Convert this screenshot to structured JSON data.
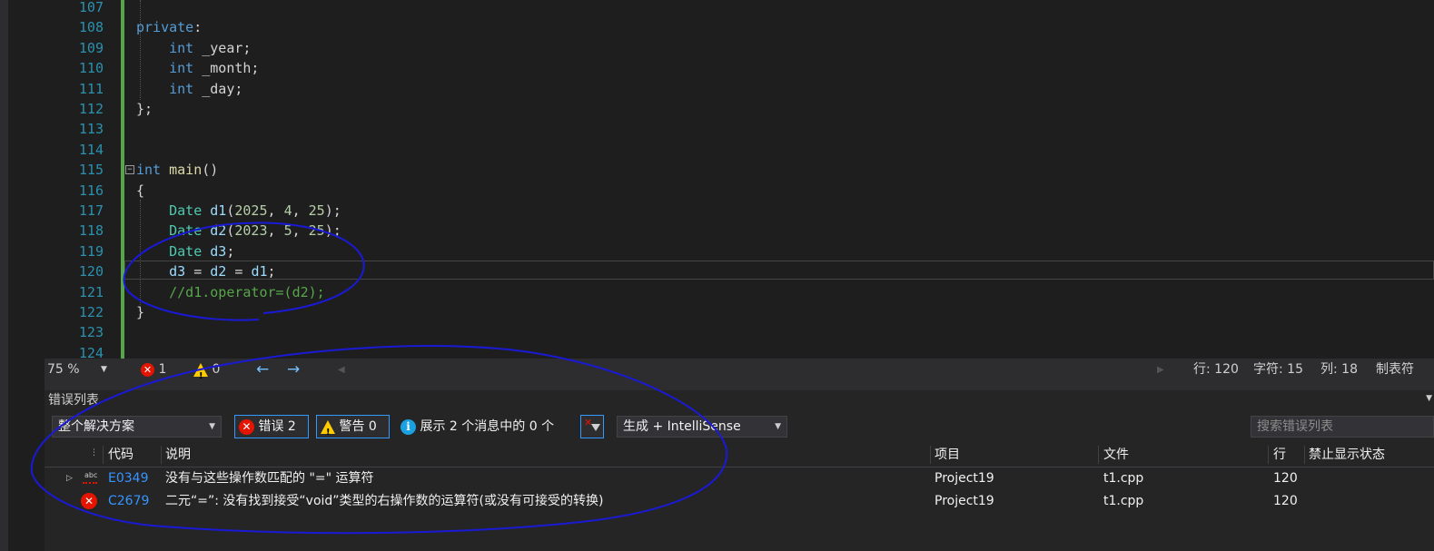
{
  "editor": {
    "lines": [
      {
        "num": "107",
        "tokens": []
      },
      {
        "num": "108",
        "tokens": [
          {
            "t": "private",
            "c": "kw"
          },
          {
            "t": ":",
            "c": "plain"
          }
        ]
      },
      {
        "num": "109",
        "tokens": [
          {
            "t": "    int",
            "c": "kw"
          },
          {
            "t": " _year;",
            "c": "plain"
          }
        ]
      },
      {
        "num": "110",
        "tokens": [
          {
            "t": "    int",
            "c": "kw"
          },
          {
            "t": " _month;",
            "c": "plain"
          }
        ]
      },
      {
        "num": "111",
        "tokens": [
          {
            "t": "    int",
            "c": "kw"
          },
          {
            "t": " _day;",
            "c": "plain"
          }
        ]
      },
      {
        "num": "112",
        "tokens": [
          {
            "t": "};",
            "c": "plain"
          }
        ]
      },
      {
        "num": "113",
        "tokens": []
      },
      {
        "num": "114",
        "tokens": []
      },
      {
        "num": "115",
        "tokens": [
          {
            "t": "int",
            "c": "kw"
          },
          {
            "t": " ",
            "c": "plain"
          },
          {
            "t": "main",
            "c": "fn"
          },
          {
            "t": "()",
            "c": "plain"
          }
        ]
      },
      {
        "num": "116",
        "tokens": [
          {
            "t": "{",
            "c": "plain"
          }
        ]
      },
      {
        "num": "117",
        "tokens": [
          {
            "t": "    Date",
            "c": "ty"
          },
          {
            "t": " ",
            "c": "plain"
          },
          {
            "t": "d1",
            "c": "var"
          },
          {
            "t": "(",
            "c": "plain"
          },
          {
            "t": "2025",
            "c": "num"
          },
          {
            "t": ", ",
            "c": "plain"
          },
          {
            "t": "4",
            "c": "num"
          },
          {
            "t": ", ",
            "c": "plain"
          },
          {
            "t": "25",
            "c": "num"
          },
          {
            "t": ");",
            "c": "plain"
          }
        ]
      },
      {
        "num": "118",
        "tokens": [
          {
            "t": "    Date",
            "c": "ty"
          },
          {
            "t": " ",
            "c": "plain"
          },
          {
            "t": "d2",
            "c": "var"
          },
          {
            "t": "(",
            "c": "plain"
          },
          {
            "t": "2023",
            "c": "num"
          },
          {
            "t": ", ",
            "c": "plain"
          },
          {
            "t": "5",
            "c": "num"
          },
          {
            "t": ", ",
            "c": "plain"
          },
          {
            "t": "25",
            "c": "num"
          },
          {
            "t": ");",
            "c": "plain"
          }
        ]
      },
      {
        "num": "119",
        "tokens": [
          {
            "t": "    Date",
            "c": "ty"
          },
          {
            "t": " ",
            "c": "plain"
          },
          {
            "t": "d3",
            "c": "var"
          },
          {
            "t": ";",
            "c": "plain"
          }
        ]
      },
      {
        "num": "120",
        "tokens": [
          {
            "t": "    d3",
            "c": "var"
          },
          {
            "t": " = ",
            "c": "plain"
          },
          {
            "t": "d2",
            "c": "var"
          },
          {
            "t": " = ",
            "c": "plain"
          },
          {
            "t": "d1",
            "c": "var"
          },
          {
            "t": ";",
            "c": "plain"
          }
        ]
      },
      {
        "num": "121",
        "tokens": [
          {
            "t": "    //d1.operator=(d2);",
            "c": "cm"
          }
        ]
      },
      {
        "num": "122",
        "tokens": [
          {
            "t": "}",
            "c": "plain"
          }
        ]
      },
      {
        "num": "123",
        "tokens": []
      },
      {
        "num": "124",
        "tokens": []
      }
    ]
  },
  "statusbar": {
    "zoom": "75 %",
    "error_count": "1",
    "warning_count": "0",
    "nav_back": "←",
    "nav_forward": "→",
    "row": "行: 120",
    "char": "字符: 15",
    "col": "列: 18",
    "tabs": "制表符"
  },
  "errlist": {
    "title": "错误列表",
    "scope": "整个解决方案",
    "errors_btn": "错误 2",
    "warnings_btn": "警告 0",
    "messages": "展示 2 个消息中的 0 个",
    "build_filter": "生成 + IntelliSense",
    "search_placeholder": "搜索错误列表",
    "headers": {
      "code": "代码",
      "desc": "说明",
      "project": "项目",
      "file": "文件",
      "line": "行",
      "suppress": "禁止显示状态"
    },
    "rows": [
      {
        "code": "E0349",
        "desc": "没有与这些操作数匹配的 \"=\" 运算符",
        "project": "Project19",
        "file": "t1.cpp",
        "line": "120"
      },
      {
        "code": "C2679",
        "desc": "二元“=”: 没有找到接受“void”类型的右操作数的运算符(或没有可接受的转换)",
        "project": "Project19",
        "file": "t1.cpp",
        "line": "120"
      }
    ]
  },
  "colors": {
    "accent": "#3399ff",
    "error": "#e51400",
    "warning": "#ffcc00",
    "ink": "#1a1ad6"
  }
}
